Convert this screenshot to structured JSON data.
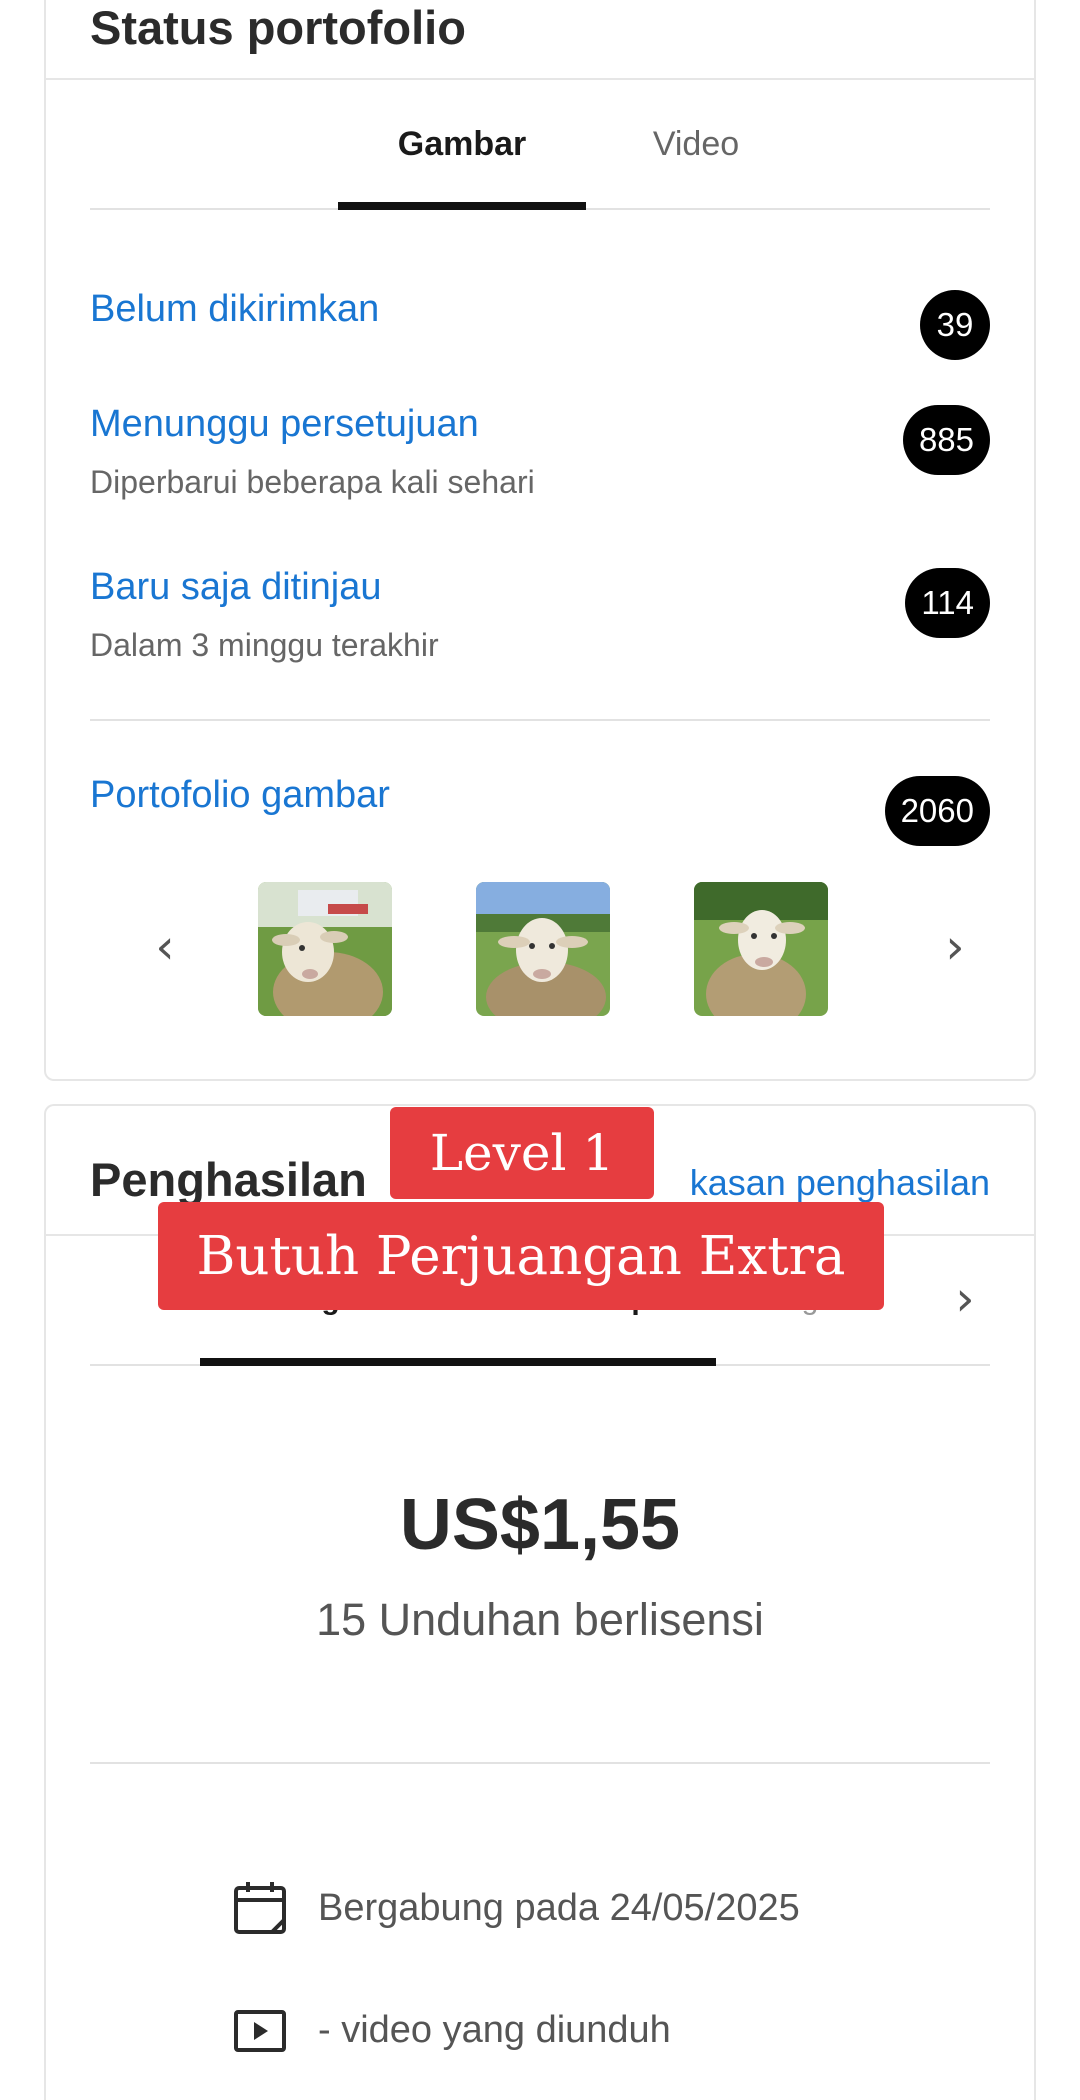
{
  "portfolio": {
    "title": "Status portofolio",
    "tabs": [
      {
        "label": "Gambar",
        "active": true
      },
      {
        "label": "Video",
        "active": false
      }
    ],
    "rows": [
      {
        "label": "Belum dikirimkan",
        "sub": "",
        "count": "39"
      },
      {
        "label": "Menunggu persetujuan",
        "sub": "Diperbarui beberapa kali sehari",
        "count": "885"
      },
      {
        "label": "Baru saja ditinjau",
        "sub": "Dalam 3 minggu terakhir",
        "count": "114"
      }
    ],
    "image_portfolio": {
      "label": "Portofolio gambar",
      "count": "2060"
    },
    "prev_icon": "chevron-left-icon",
    "next_icon": "chevron-right-icon",
    "thumbnails": [
      "sheep-photo-1",
      "sheep-photo-2",
      "sheep-photo-3"
    ]
  },
  "earnings": {
    "title": "Penghasilan",
    "summary_link": "kasan penghasilan",
    "tabs": [
      {
        "label": "Penghasilan seumur hidup",
        "active": true
      },
      {
        "label": "Pengha",
        "active": false
      }
    ],
    "tabs_next_icon": "chevron-right-icon",
    "amount": "US$1,55",
    "downloads": "15 Unduhan berlisensi",
    "joined": "Bergabung pada 24/05/2025",
    "videos_downloaded": "- video yang diunduh",
    "joined_icon": "calendar-icon",
    "video_icon": "video-play-icon"
  },
  "overlay": {
    "line1": "Level 1",
    "line2": "Butuh Perjuangan Extra",
    "color": "#e63d40"
  },
  "colors": {
    "link": "#1976d2",
    "badge": "#000000"
  }
}
